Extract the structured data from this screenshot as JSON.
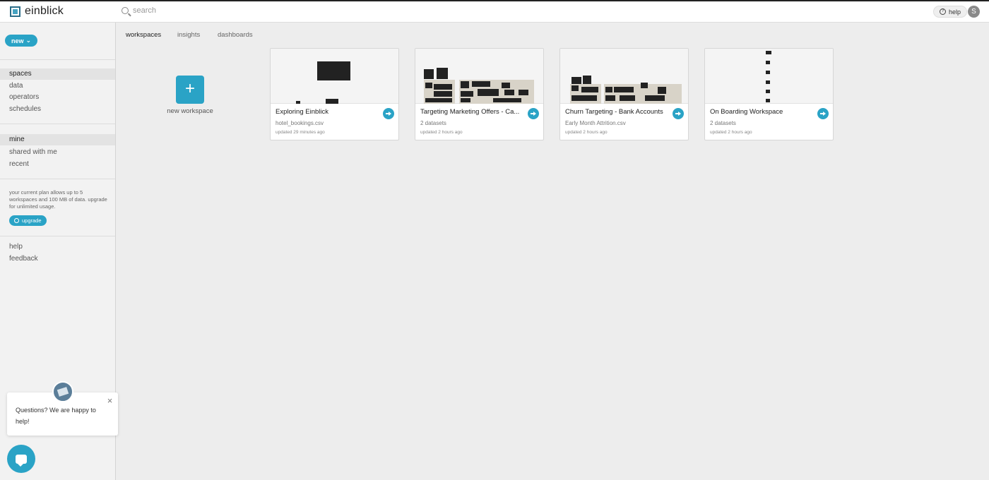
{
  "app": {
    "name": "einblick"
  },
  "search": {
    "placeholder": "search"
  },
  "header": {
    "help_label": "help",
    "user_initial": "S"
  },
  "sidebar": {
    "new_label": "new",
    "section1": [
      "spaces",
      "data",
      "operators",
      "schedules"
    ],
    "section2": [
      "mine",
      "shared with me",
      "recent"
    ],
    "plan_text": "your current plan allows up to 5 workspaces and 100 MB of data. upgrade for unlimited usage.",
    "upgrade_label": "upgrade",
    "section3": [
      "help",
      "feedback"
    ]
  },
  "tabs": [
    "workspaces",
    "insights",
    "dashboards"
  ],
  "new_workspace": {
    "icon": "+",
    "label": "new workspace"
  },
  "workspaces": [
    {
      "title": "Exploring Einblick",
      "subtitle": "hotel_bookings.csv",
      "updated": "updated 29 minutes ago"
    },
    {
      "title": "Targeting Marketing Offers - Ca...",
      "subtitle": "2 datasets",
      "updated": "updated 2 hours ago"
    },
    {
      "title": "Churn Targeting - Bank Accounts",
      "subtitle": "Early Month Attrition.csv",
      "updated": "updated 2 hours ago"
    },
    {
      "title": "On Boarding Workspace",
      "subtitle": "2 datasets",
      "updated": "updated 2 hours ago"
    }
  ],
  "chat": {
    "message": "Questions? We are happy to help!",
    "close_icon": "×"
  },
  "colors": {
    "accent": "#2aa3c6",
    "sidebar_bg": "#f2f2f2",
    "page_bg": "#ededed"
  }
}
